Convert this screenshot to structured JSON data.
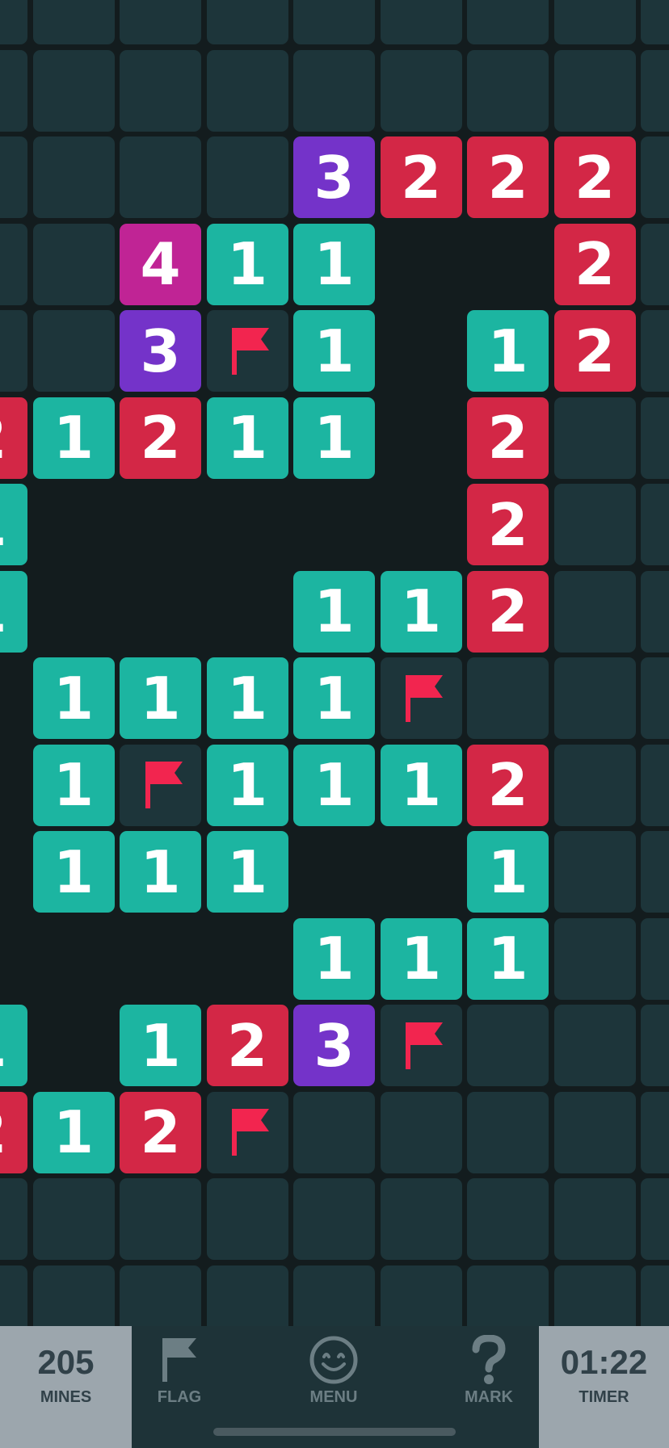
{
  "colors": {
    "background": "#131c1e",
    "hidden_cell": "#1d353a",
    "number_1": "#1cb5a1",
    "number_2": "#d32746",
    "number_3": "#7433c9",
    "number_4": "#c02495",
    "flag": "#f2254f"
  },
  "board": {
    "columns": 9,
    "rows": 16,
    "legend": "# = hidden cell, . = opened empty cell, F = flag, digit = revealed number",
    "grid": [
      "#########",
      "#########",
      "####3222#",
      "##411..2#",
      "##3F1.12#",
      "21211.2##",
      "1.....2##",
      "1...112##",
      ".1111F###",
      ".1F1112##",
      ".111..1##",
      "....111##",
      "1.123F###",
      "212F#####",
      "#########",
      "#########"
    ]
  },
  "bottom_bar": {
    "mines": {
      "value": "205",
      "label": "MINES"
    },
    "flag": {
      "label": "FLAG",
      "icon": "flag-icon"
    },
    "menu": {
      "label": "MENU",
      "icon": "smiley-icon"
    },
    "mark": {
      "label": "MARK",
      "icon": "question-mark-icon"
    },
    "timer": {
      "value": "01:22",
      "label": "TIMER"
    }
  }
}
